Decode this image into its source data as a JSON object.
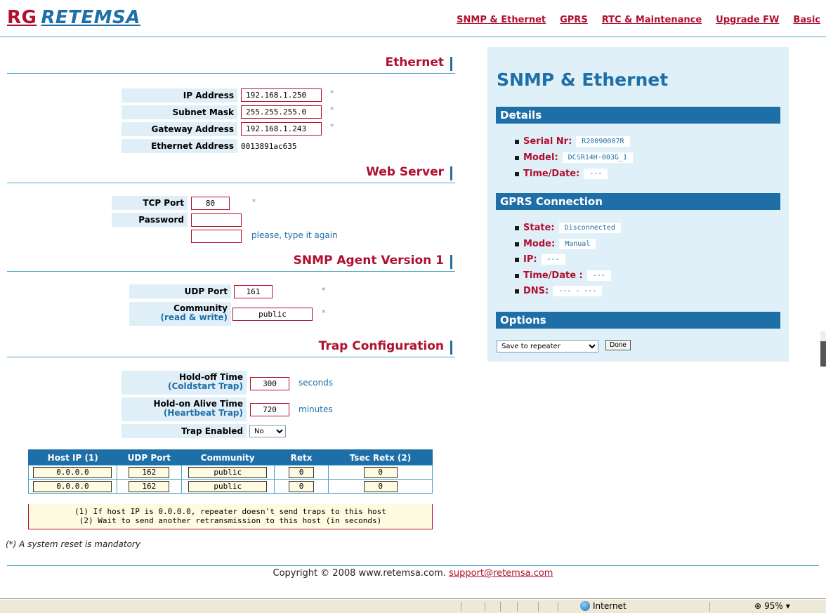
{
  "header": {
    "logo_rg": "RG",
    "logo_brand": "RETEMSA",
    "nav": [
      "SNMP & Ethernet",
      "GPRS",
      "RTC & Maintenance",
      "Upgrade FW",
      "Basic"
    ]
  },
  "ethernet": {
    "title": "Ethernet",
    "ip_label": "IP Address",
    "ip_value": "192.168.1.250",
    "mask_label": "Subnet Mask",
    "mask_value": "255.255.255.0",
    "gateway_label": "Gateway Address",
    "gateway_value": "192.168.1.243",
    "mac_label": "Ethernet Address",
    "mac_value": "0013891ac635",
    "asterisk": "*"
  },
  "webserver": {
    "title": "Web Server",
    "tcp_label": "TCP Port",
    "tcp_value": "80",
    "password_label": "Password",
    "retype_note": "please, type it again"
  },
  "snmp": {
    "title": "SNMP Agent Version 1",
    "udp_label": "UDP Port",
    "udp_value": "161",
    "community_label": "Community",
    "community_sub": "(read & write)",
    "community_value": "public"
  },
  "trap": {
    "title": "Trap Configuration",
    "holdoff_label": "Hold-off Time",
    "holdoff_sub": "(Coldstart Trap)",
    "holdoff_value": "300",
    "holdoff_unit": "seconds",
    "holdon_label": "Hold-on Alive Time",
    "holdon_sub": "(Heartbeat Trap)",
    "holdon_value": "720",
    "holdon_unit": "minutes",
    "enabled_label": "Trap Enabled",
    "enabled_value": "No"
  },
  "hosts": {
    "headers": [
      "Host IP (1)",
      "UDP Port",
      "Community",
      "Retx",
      "Tsec Retx (2)"
    ],
    "rows": [
      {
        "ip": "0.0.0.0",
        "port": "162",
        "community": "public",
        "retx": "0",
        "tsec": "0"
      },
      {
        "ip": "0.0.0.0",
        "port": "162",
        "community": "public",
        "retx": "0",
        "tsec": "0"
      }
    ],
    "note1": "(1) If host IP is 0.0.0.0, repeater doesn't send traps to this host",
    "note2": "(2) Wait to send another retransmission to this host (in seconds)"
  },
  "reset_note": "(*) A system reset is mandatory",
  "panel": {
    "title": "SNMP & Ethernet",
    "details_title": "Details",
    "serial_label": "Serial Nr:",
    "serial_value": "R20090007R",
    "model_label": "Model:",
    "model_value": "DCSR14H-003G_1",
    "time_label": "Time/Date:",
    "time_value": "---",
    "gprs_title": "GPRS Connection",
    "state_label": "State:",
    "state_value": "Disconnected",
    "mode_label": "Mode:",
    "mode_value": "Manual",
    "ip_label": "IP:",
    "ip_value": "---",
    "gtime_label": "Time/Date :",
    "gtime_value": "---",
    "dns_label": "DNS:",
    "dns_value": "--- - ---",
    "options_title": "Options",
    "save_option": "Save to repeater",
    "done_label": "Done"
  },
  "footer": {
    "copyright": "Copyright © 2008 www.retemsa.com.",
    "email": "support@retemsa.com"
  },
  "statusbar": {
    "zone": "Internet",
    "zoom": "95%"
  }
}
